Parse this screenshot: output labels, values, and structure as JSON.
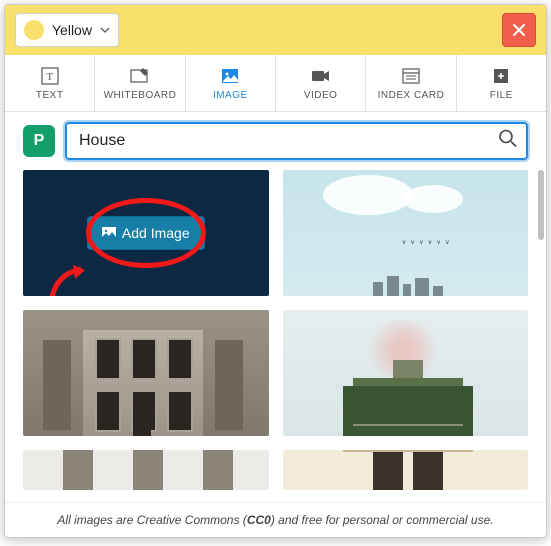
{
  "header": {
    "color_label": "Yellow",
    "color_swatch": "#F9DF6C"
  },
  "tabs": [
    {
      "label": "TEXT",
      "id": "text"
    },
    {
      "label": "WHITEBOARD",
      "id": "whiteboard"
    },
    {
      "label": "IMAGE",
      "id": "image",
      "active": true
    },
    {
      "label": "VIDEO",
      "id": "video"
    },
    {
      "label": "INDEX CARD",
      "id": "index-card"
    },
    {
      "label": "FILE",
      "id": "file"
    }
  ],
  "search": {
    "provider": "P",
    "value": "House",
    "placeholder": ""
  },
  "addimage": {
    "label": "Add Image"
  },
  "footer": {
    "prefix": "All images are Creative Commons (",
    "bold": "CC0",
    "suffix": ") and free for personal or commercial use."
  }
}
